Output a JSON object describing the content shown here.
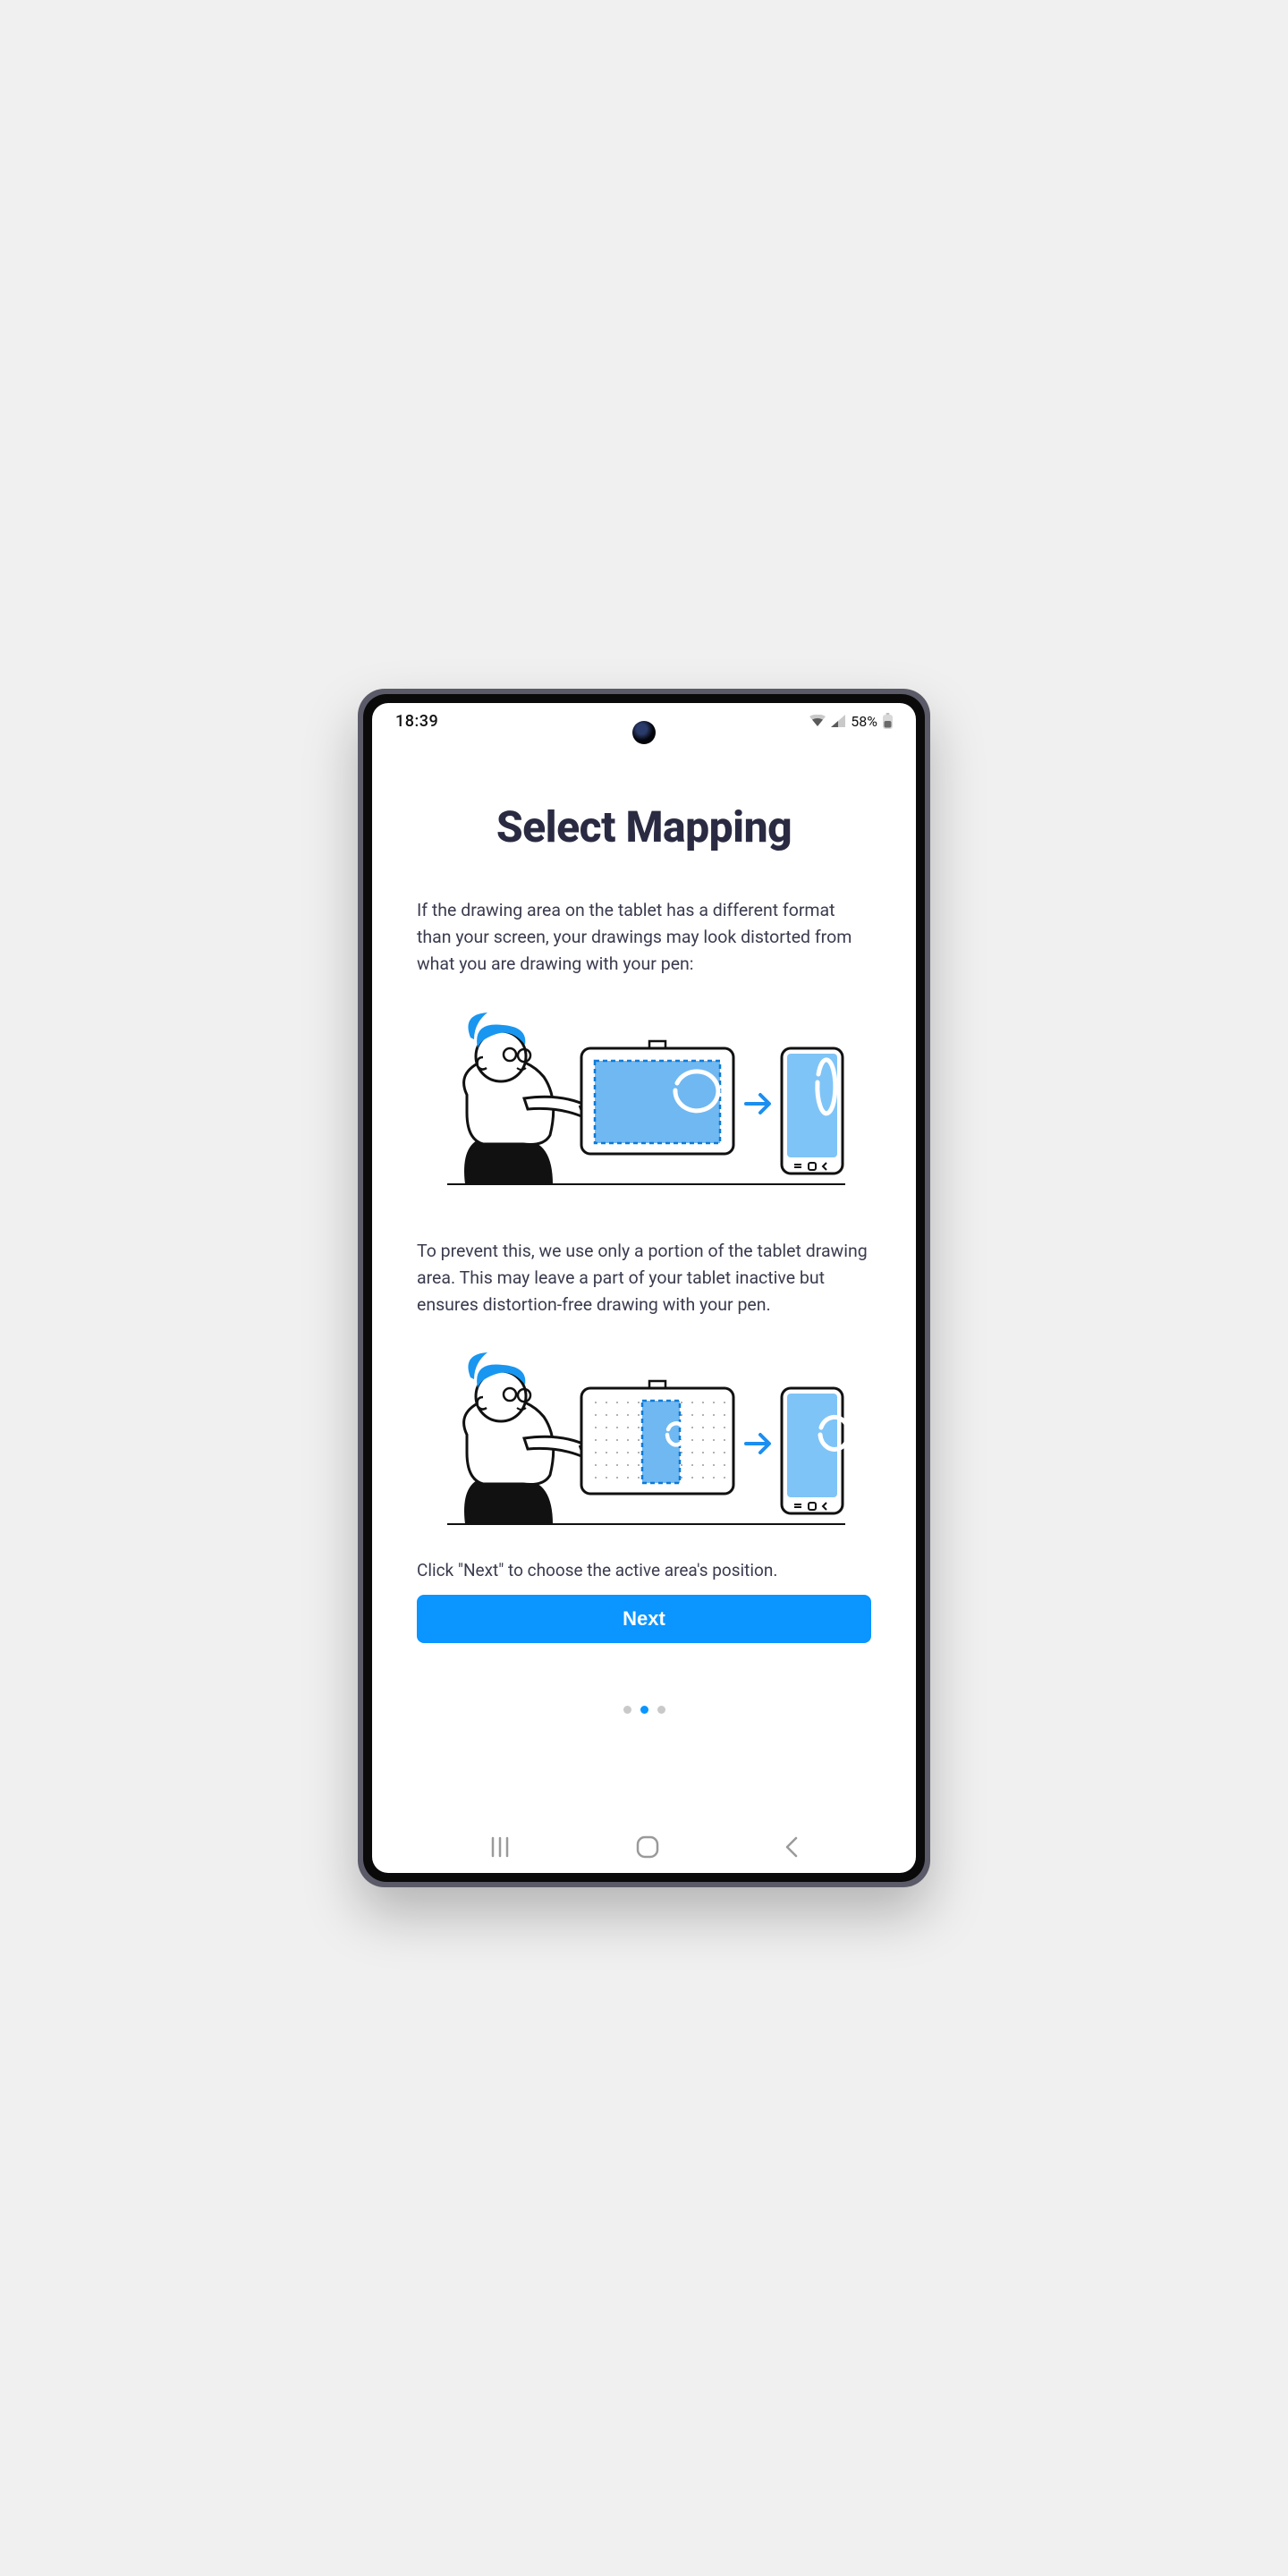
{
  "status": {
    "time": "18:39",
    "battery_text": "58%"
  },
  "title": "Select Mapping",
  "paragraph1": "If the drawing area on the tablet has a different format than your screen, your drawings may look distorted from what you are drawing with your pen:",
  "paragraph2": "To prevent this, we use only a portion of the tablet drawing area. This may leave a part of your tablet inactive but ensures distortion-free drawing with your pen.",
  "cta_text": "Click \"Next\" to choose the active area's position.",
  "next_label": "Next",
  "pager": {
    "count": 3,
    "active_index": 1
  }
}
